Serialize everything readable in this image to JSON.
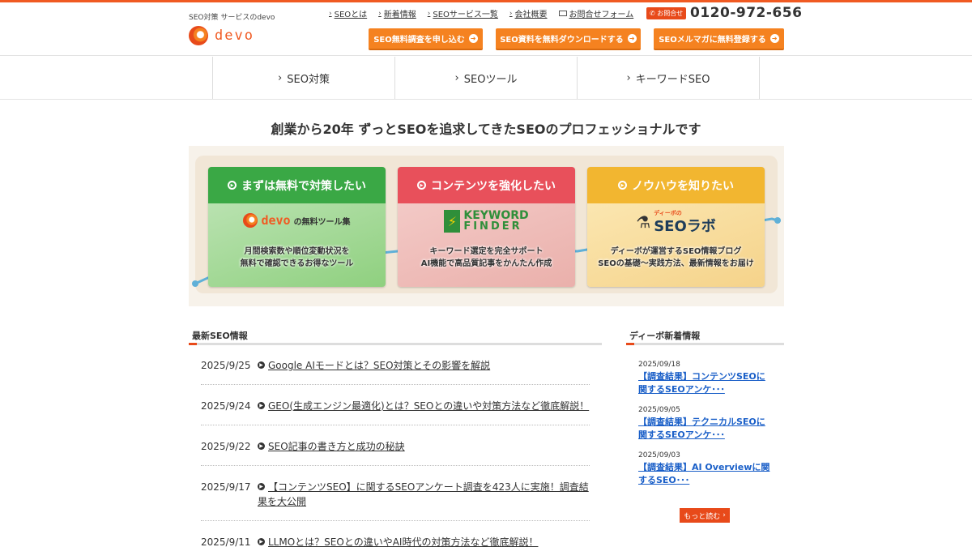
{
  "header": {
    "tagline": "SEO対策 サービスのdevo",
    "logo_text": "devo",
    "links": [
      {
        "label": "SEOとは"
      },
      {
        "label": "新着情報"
      },
      {
        "label": "SEOサービス一覧"
      },
      {
        "label": "会社概要"
      },
      {
        "label": "お問合せフォーム"
      }
    ],
    "phone_badge": "お問合せ",
    "phone_number": "0120-972-656",
    "cta": [
      {
        "label": "SEO無料調査を申し込む"
      },
      {
        "label": "SEO資料を無料ダウンロードする"
      },
      {
        "label": "SEOメルマガに無料登録する"
      }
    ],
    "colors": {
      "accent": "#f05a22",
      "cta": "#f58220",
      "link": "#1a5fc8"
    }
  },
  "nav": [
    {
      "label": "SEO対策"
    },
    {
      "label": "SEOツール"
    },
    {
      "label": "キーワードSEO"
    }
  ],
  "headline": "創業から20年 ずっとSEOを追求してきたSEOのプロフェッショナルです",
  "banner": {
    "cards": [
      {
        "title": "まずは無料で対策したい",
        "logo": "devo",
        "logo_suffix": "の無料ツール集",
        "line1": "月間検索数や順位変動状況を",
        "line2": "無料で確認できるお得なツール",
        "color": "#3aa845"
      },
      {
        "title": "コンテンツを強化したい",
        "logo": "KEYWORD",
        "logo2": "FINDER",
        "line1": "キーワード選定を完全サポート",
        "line2": "AI機能で高品質記事をかんたん作成",
        "color": "#e8505b"
      },
      {
        "title": "ノウハウを知りたい",
        "logo_small": "ディーボの",
        "logo": "SEOラボ",
        "line1": "ディーボが運営するSEO情報ブログ",
        "line2": "SEOの基礎〜実践方法、最新情報をお届け",
        "color": "#f2b630"
      }
    ]
  },
  "news": {
    "title": "最新SEO情報",
    "items": [
      {
        "date": "2025/9/25",
        "text": "Google AIモードとは？SEO対策とその影響を解説"
      },
      {
        "date": "2025/9/24",
        "text": "GEO(生成エンジン最適化)とは？SEOとの違いや対策方法など徹底解説！"
      },
      {
        "date": "2025/9/22",
        "text": "SEO記事の書き方と成功の秘訣"
      },
      {
        "date": "2025/9/17",
        "text": "【コンテンツSEO】に関するSEOアンケート調査を423人に実施！調査結果を大公開"
      },
      {
        "date": "2025/9/11",
        "text": "LLMOとは？SEOとの違いやAI時代の対策方法など徹底解説！"
      }
    ]
  },
  "side": {
    "title": "ディーボ新着情報",
    "items": [
      {
        "date": "2025/09/18",
        "line1": "【調査結果】コンテンツSEOに",
        "line2": "関するSEOアンケ･･･"
      },
      {
        "date": "2025/09/05",
        "line1": "【調査結果】テクニカルSEOに",
        "line2": "関するSEOアンケ･･･"
      },
      {
        "date": "2025/09/03",
        "line1": "【調査結果】AI Overviewに関",
        "line2": "するSEO･･･"
      }
    ],
    "more_label": "もっと読む"
  }
}
